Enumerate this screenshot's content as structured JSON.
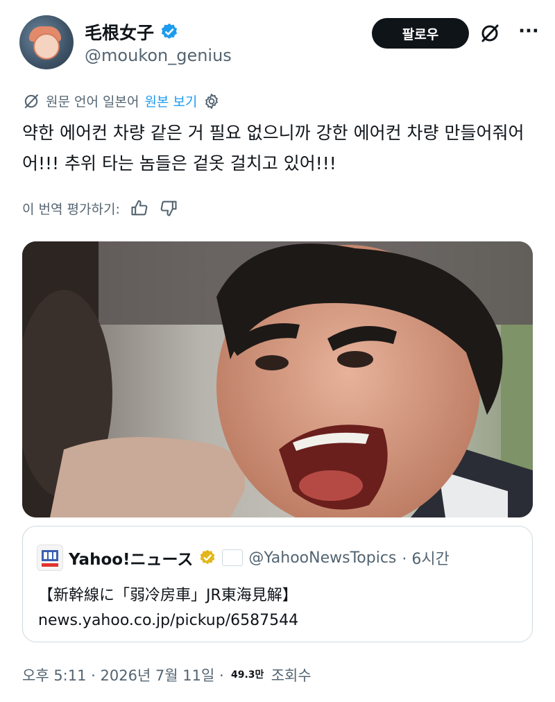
{
  "author": {
    "display_name": "毛根女子",
    "handle": "@moukon_genius"
  },
  "actions": {
    "follow_label": "팔로우",
    "more_label": "···"
  },
  "translation": {
    "source_language": "원문 언어 일본어",
    "show_original": "원본 보기"
  },
  "tweet": {
    "text": "약한 에어컨 차량 같은 거 필요 없으니까 강한 에어컨 차량 만들어줘어어!!! 추위 타는 놈들은 겉옷 걸치고 있어!!!"
  },
  "rating": {
    "label": "이 번역 평가하기:"
  },
  "quote": {
    "name": "Yahoo!ニュース",
    "handle": "@YahooNewsTopics",
    "time": "· 6시간",
    "title": "【新幹線に「弱冷房車」JR東海見解】",
    "url": "news.yahoo.co.jp/pickup/6587544"
  },
  "meta": {
    "timestamp": "오후 5:11 · 2026년 7월 11일 ·",
    "views_count": "49.3만",
    "views_label": "조회수"
  },
  "colors": {
    "accent": "#1d9bf0",
    "text": "#0f1419",
    "secondary": "#536471",
    "verified_blue": "#1d9bf0",
    "verified_gold": "#e2b719"
  }
}
